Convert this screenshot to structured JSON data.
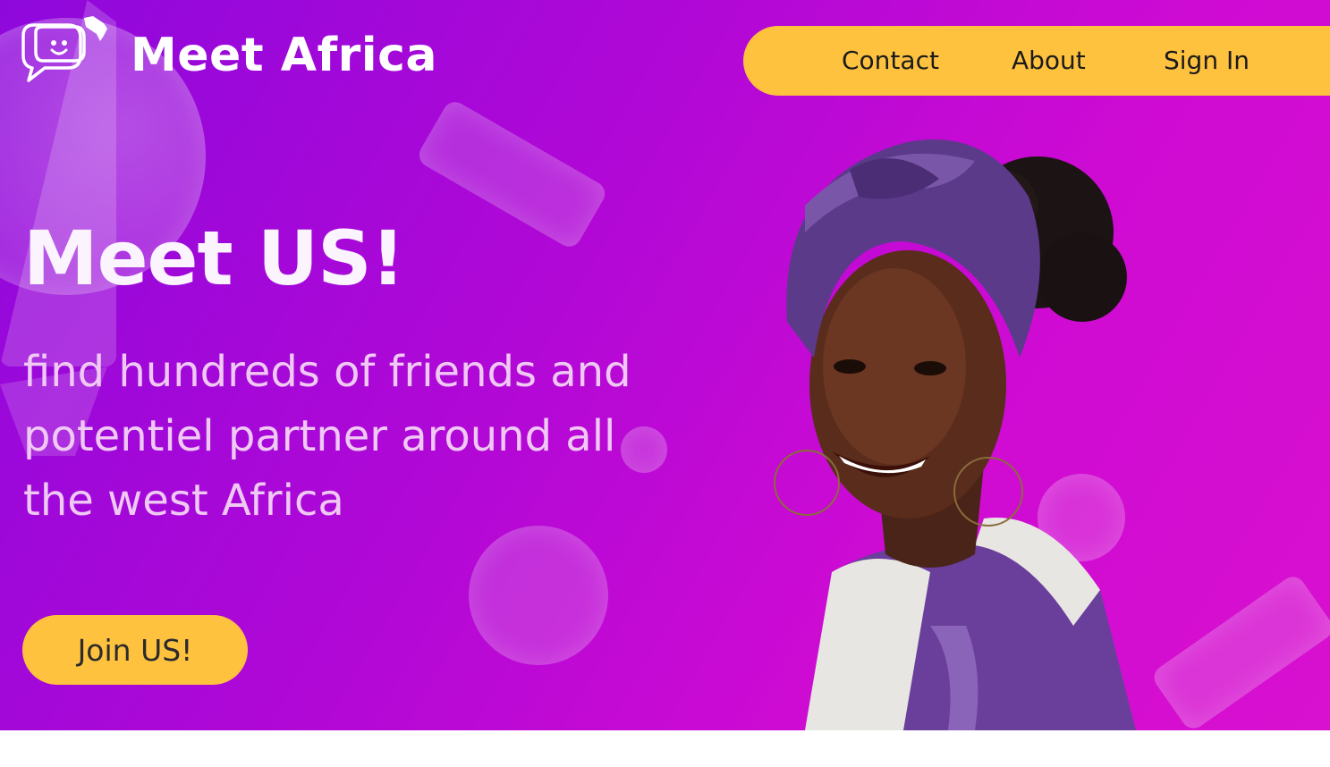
{
  "brand": {
    "name": "Meet Africa",
    "logo_icon": "chat-bubble-africa-icon"
  },
  "nav": {
    "items": [
      "Contact",
      "About",
      "Sign In"
    ]
  },
  "hero": {
    "headline": "Meet US!",
    "subtext_lines": [
      "find hundreds of friends and",
      "potentiel partner around all",
      "the west Africa"
    ],
    "cta_label": "Join US!",
    "illustration": "smiling-woman-headwrap-portrait"
  },
  "colors": {
    "accent": "#ffc23f",
    "gradient_start": "#8e08dc",
    "gradient_end": "#d810cf",
    "text_light": "#ffffff"
  }
}
